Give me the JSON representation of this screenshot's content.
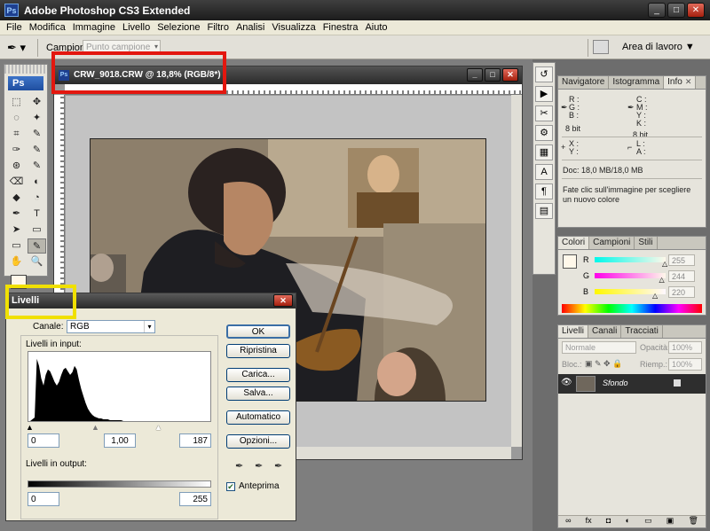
{
  "app": {
    "title": "Adobe Photoshop CS3 Extended",
    "logo": "Ps",
    "window_buttons": [
      "_",
      "□",
      "✕"
    ]
  },
  "menu": [
    "File",
    "Modifica",
    "Immagine",
    "Livello",
    "Selezione",
    "Filtro",
    "Analisi",
    "Visualizza",
    "Finestra",
    "Aiuto"
  ],
  "options_bar": {
    "tool_icon": "eyedropper-icon",
    "sample_label": "Campione:",
    "sample_value": "Punto campione",
    "workspace_label": "Area di lavoro ▼"
  },
  "toolbox": {
    "logo": "Ps",
    "tools": [
      "⬚",
      "✥",
      "◌",
      "✦",
      "⌗",
      "✎",
      "✑",
      "✎",
      "⊛",
      "✎",
      "⌫",
      "◐",
      "◆",
      "◔",
      "✒",
      "T",
      "➤",
      "▭",
      "▭",
      "✎",
      "✋",
      "🔍"
    ]
  },
  "document": {
    "title": "CRW_9018.CRW @ 18,8% (RGB/8*)",
    "logo": "Ps",
    "buttons": [
      "_",
      "□",
      "✕"
    ]
  },
  "right_icons": [
    "↺",
    "▶",
    "✂",
    "⚙",
    "▦",
    "A",
    "¶",
    "▤"
  ],
  "info_panel": {
    "tabs": [
      "Navigatore",
      "Istogramma",
      "Info"
    ],
    "rgb_labels": [
      "R :",
      "G :",
      "B :"
    ],
    "cmyk_labels": [
      "C :",
      "M :",
      "Y :",
      "K :"
    ],
    "bits_left": "8 bit",
    "bits_right": "8 bit",
    "xy_labels": [
      "X :",
      "Y :"
    ],
    "la_labels": [
      "L :",
      "A :"
    ],
    "doc": "Doc: 18,0 MB/18,0 MB",
    "hint": "Fate clic sull'immagine per scegliere un nuovo colore"
  },
  "colors_panel": {
    "tabs": [
      "Colori",
      "Campioni",
      "Stili"
    ],
    "channels": [
      {
        "label": "R",
        "value": "255",
        "pct": 1.0,
        "gradient": "linear-gradient(90deg,#00f8ea,#fff8ea)"
      },
      {
        "label": "G",
        "value": "244",
        "pct": 0.957,
        "gradient": "linear-gradient(90deg,#ff00ea,#fff8ea)"
      },
      {
        "label": "B",
        "value": "220",
        "pct": 0.863,
        "gradient": "linear-gradient(90deg,#fff800,#fff8ff)"
      }
    ]
  },
  "layers_panel": {
    "tabs": [
      "Livelli",
      "Canali",
      "Tracciati"
    ],
    "blend_mode": "Normale",
    "opacity_label": "Opacità:",
    "opacity_value": "100%",
    "lock_label": "Bloc.:",
    "fill_label": "Riemp.:",
    "fill_value": "100%",
    "layer_name": "Sfondo",
    "footer_icons": [
      "∞",
      "fx",
      "◘",
      "◐",
      "▭",
      "▣",
      "🗑"
    ]
  },
  "levels_dialog": {
    "title": "Livelli",
    "channel_label": "Canale:",
    "channel_value": "RGB",
    "input_label": "Livelli in input:",
    "input_values": [
      "0",
      "1,00",
      "187"
    ],
    "output_label": "Livelli in output:",
    "output_values": [
      "0",
      "255"
    ],
    "buttons": [
      "OK",
      "Ripristina",
      "Carica...",
      "Salva...",
      "Automatico",
      "Opzioni..."
    ],
    "preview_label": "Anteprima",
    "preview_checked": true,
    "histogram": [
      0,
      2,
      4,
      70,
      62,
      48,
      40,
      52,
      58,
      56,
      50,
      44,
      40,
      44,
      52,
      58,
      60,
      56,
      52,
      55,
      62,
      58,
      46,
      36,
      28,
      20,
      14,
      10,
      7,
      5,
      4,
      3,
      3,
      2,
      2,
      2,
      1,
      1,
      1,
      1,
      1,
      1,
      0,
      0,
      0,
      0,
      0,
      0,
      0,
      0,
      0,
      0,
      0,
      0,
      0,
      0,
      0,
      0,
      0,
      0
    ]
  }
}
